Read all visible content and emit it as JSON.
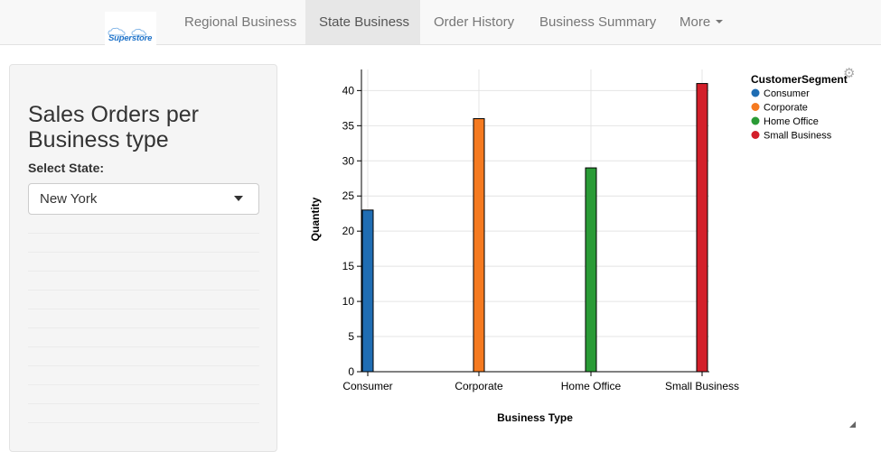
{
  "brand": {
    "logo_text": "Superstore",
    "logo_color": "#1f73c9"
  },
  "nav": {
    "items": [
      {
        "label": "Regional Business",
        "active": false
      },
      {
        "label": "State Business",
        "active": true
      },
      {
        "label": "Order History",
        "active": false
      },
      {
        "label": "Business Summary",
        "active": false
      },
      {
        "label": "More",
        "active": false,
        "dropdown": true
      }
    ]
  },
  "sidebar": {
    "title": "Sales Orders per Business type",
    "select_label": "Select State:",
    "selected_state": "New York"
  },
  "controls": {
    "gear_icon": "gear-icon",
    "resize_icon": "resize-handle-icon"
  },
  "chart_data": {
    "type": "bar",
    "categories": [
      "Consumer",
      "Corporate",
      "Home Office",
      "Small Business"
    ],
    "values": [
      23,
      36,
      29,
      41
    ],
    "colors": [
      "#1f6db3",
      "#f57a20",
      "#2a9b36",
      "#d31f2a"
    ],
    "xlabel": "Business Type",
    "ylabel": "Quantity",
    "ylim": [
      0,
      43
    ],
    "yticks": [
      0,
      5,
      10,
      15,
      20,
      25,
      30,
      35,
      40
    ],
    "grid": true,
    "legend": {
      "title": "CustomerSegment",
      "placement": "top-right",
      "entries": [
        "Consumer",
        "Corporate",
        "Home Office",
        "Small Business"
      ]
    }
  }
}
